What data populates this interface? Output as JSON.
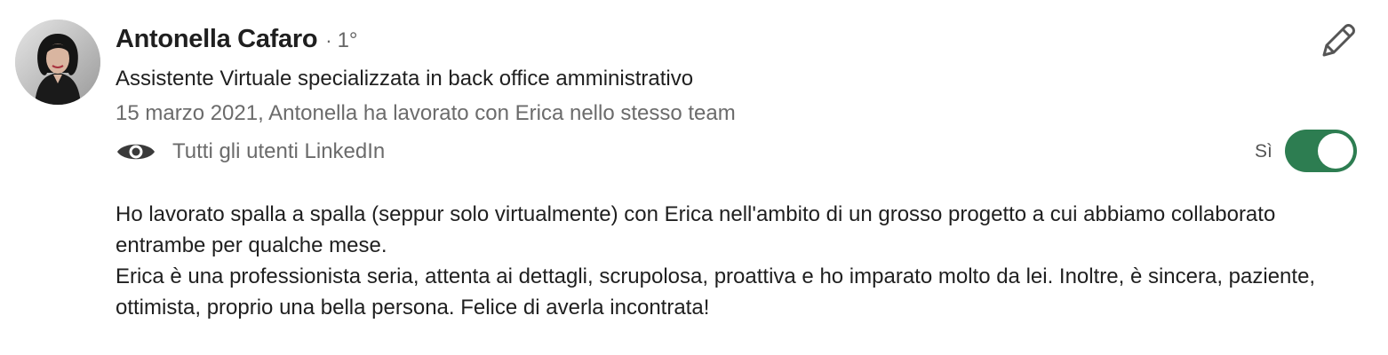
{
  "recommendation": {
    "author": {
      "name": "Antonella Cafaro",
      "separator": "·",
      "degree": "1°",
      "headline": "Assistente Virtuale specializzata in back office amministrativo"
    },
    "meta": "15 marzo 2021, Antonella ha lavorato con Erica nello stesso team",
    "visibility": {
      "icon": "eye-icon",
      "label": "Tutti gli utenti LinkedIn",
      "toggle_label": "Sì",
      "toggle_on": true,
      "toggle_color": "#2d7d51"
    },
    "body": {
      "paragraphs": [
        "Ho lavorato spalla a spalla (seppur solo virtualmente) con Erica nell'ambito di un grosso progetto a cui abbiamo collaborato entrambe per qualche mese.",
        "Erica è una professionista seria, attenta ai dettagli, scrupolosa, proattiva e ho imparato molto da lei. Inoltre, è sincera, paziente, ottimista, proprio una bella persona. Felice di averla incontrata!"
      ]
    },
    "edit_icon": "pencil-icon"
  }
}
